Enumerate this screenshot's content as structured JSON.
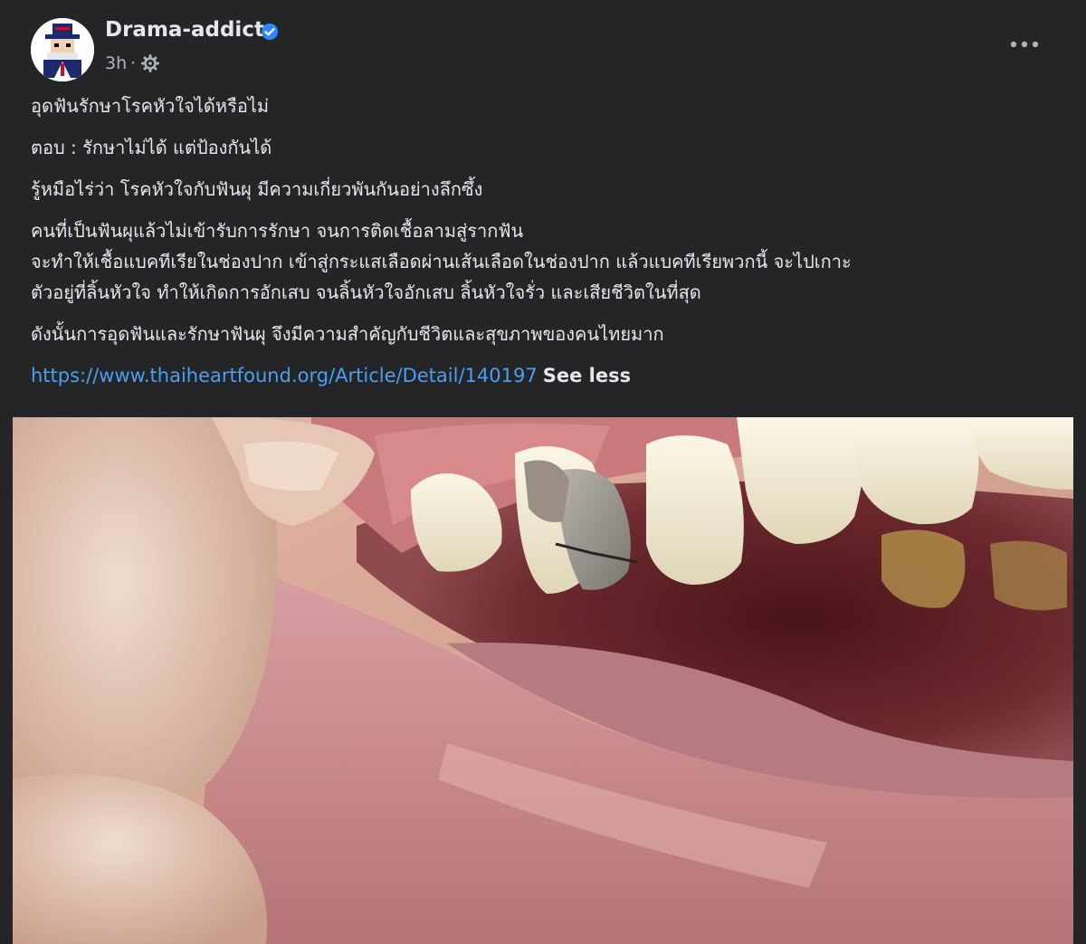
{
  "post": {
    "author": "Drama-addict",
    "verified": true,
    "time": "3h",
    "separator": "·",
    "privacy_icon": "gear-icon",
    "more_icon": "ellipsis-icon",
    "paragraphs": [
      [
        "อุดฟันรักษาโรคหัวใจได้หรือไม่"
      ],
      [
        "ตอบ : รักษาไม่ได้ แต่ป้องกันได้"
      ],
      [
        "รู้หมือไร่ว่า โรคหัวใจกับฟันผุ มีความเกี่ยวพันกันอย่างลึกซึ้ง"
      ],
      [
        "คนที่เป็นฟันผุแล้วไม่เข้ารับการรักษา จนการติดเชื้อลามสู่รากฟัน",
        "จะทำให้เชื้อแบคทีเรียในช่องปาก เข้าสู่กระแสเลือดผ่านเส้นเลือดในช่องปาก แล้วแบคทีเรียพวกนี้ จะไปเกาะ",
        "ตัวอยู่ที่ลิ้นหัวใจ ทำให้เกิดการอักเสบ จนลิ้นหัวใจอักเสบ ลิ้นหัวใจรั่ว และเสียชีวิตในที่สุด"
      ],
      [
        "ดังนั้นการอุดฟันและรักษาฟันผุ จึงมีความสำคัญกับชีวิตและสุขภาพของคนไทยมาก"
      ]
    ],
    "link": "https://www.thaiheartfound.org/Article/Detail/140197",
    "see_less": "See less",
    "colors": {
      "background": "#242526",
      "text": "#e4e6eb",
      "secondary_text": "#b0b3b8",
      "link": "#4b9ef5",
      "verified": "#2d88ff"
    }
  }
}
